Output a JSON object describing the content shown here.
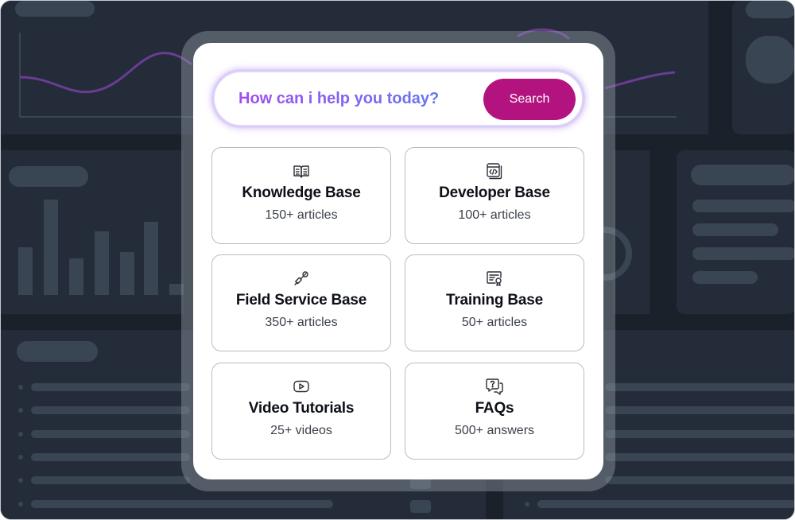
{
  "search": {
    "placeholder": "How can i help you today?",
    "button_label": "Search"
  },
  "cards": [
    {
      "title": "Knowledge Base",
      "subtitle": "150+ articles",
      "icon": "book-icon"
    },
    {
      "title": "Developer Base",
      "subtitle": "100+ articles",
      "icon": "code-file-icon"
    },
    {
      "title": "Field Service Base",
      "subtitle": "350+ articles",
      "icon": "tool-icon"
    },
    {
      "title": "Training Base",
      "subtitle": "50+ articles",
      "icon": "certificate-icon"
    },
    {
      "title": "Video Tutorials",
      "subtitle": "25+ videos",
      "icon": "play-video-icon"
    },
    {
      "title": "FAQs",
      "subtitle": "500+ answers",
      "icon": "question-chat-icon"
    }
  ],
  "colors": {
    "background": "#1a212b",
    "background_block": "#232c38",
    "placeholder_shape": "#3a4554",
    "accent_purple": "#8b5cf6",
    "button": "#b3137f",
    "card_border": "#b7bcc4"
  }
}
